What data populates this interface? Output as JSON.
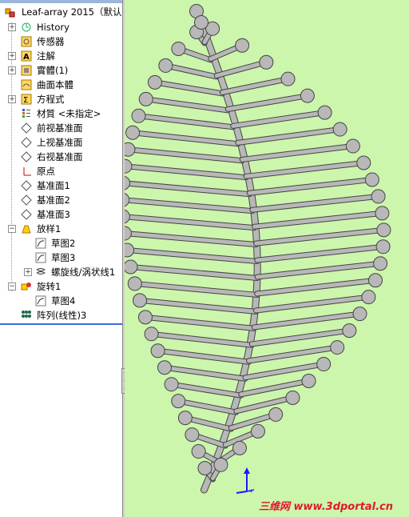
{
  "tree": {
    "root": "Leaf-array 2015（默认",
    "items": [
      {
        "label": "History",
        "icon": "history-icon",
        "expander": "+"
      },
      {
        "label": "传感器",
        "icon": "sensor-icon",
        "expander": ""
      },
      {
        "label": "注解",
        "icon": "annotation-icon",
        "expander": "+"
      },
      {
        "label": "實體(1)",
        "icon": "solid-bodies-icon",
        "expander": "+"
      },
      {
        "label": "曲面本體",
        "icon": "surface-bodies-icon",
        "expander": ""
      },
      {
        "label": "方程式",
        "icon": "equations-icon",
        "expander": "+"
      },
      {
        "label": "材質 <未指定>",
        "icon": "material-icon",
        "expander": ""
      },
      {
        "label": "前视基准面",
        "icon": "plane-icon",
        "expander": ""
      },
      {
        "label": "上视基准面",
        "icon": "plane-icon",
        "expander": ""
      },
      {
        "label": "右视基准面",
        "icon": "plane-icon",
        "expander": ""
      },
      {
        "label": "原点",
        "icon": "origin-icon",
        "expander": ""
      },
      {
        "label": "基准面1",
        "icon": "plane-icon",
        "expander": ""
      },
      {
        "label": "基准面2",
        "icon": "plane-icon",
        "expander": ""
      },
      {
        "label": "基准面3",
        "icon": "plane-icon",
        "expander": ""
      },
      {
        "label": "放样1",
        "icon": "loft-icon",
        "expander": "-"
      },
      {
        "label": "草图2",
        "icon": "sketch-icon",
        "expander": ""
      },
      {
        "label": "草图3",
        "icon": "sketch-icon",
        "expander": ""
      },
      {
        "label": "螺旋线/涡状线1",
        "icon": "helix-icon",
        "expander": "+"
      },
      {
        "label": "旋转1",
        "icon": "revolve-icon",
        "expander": "-"
      },
      {
        "label": "草图4",
        "icon": "sketch-icon",
        "expander": ""
      },
      {
        "label": "阵列(线性)3",
        "icon": "linear-pattern-icon",
        "expander": ""
      }
    ]
  },
  "viewport": {
    "background": "#ccf6ab",
    "watermark": "三维网 www.3dportal.cn"
  }
}
